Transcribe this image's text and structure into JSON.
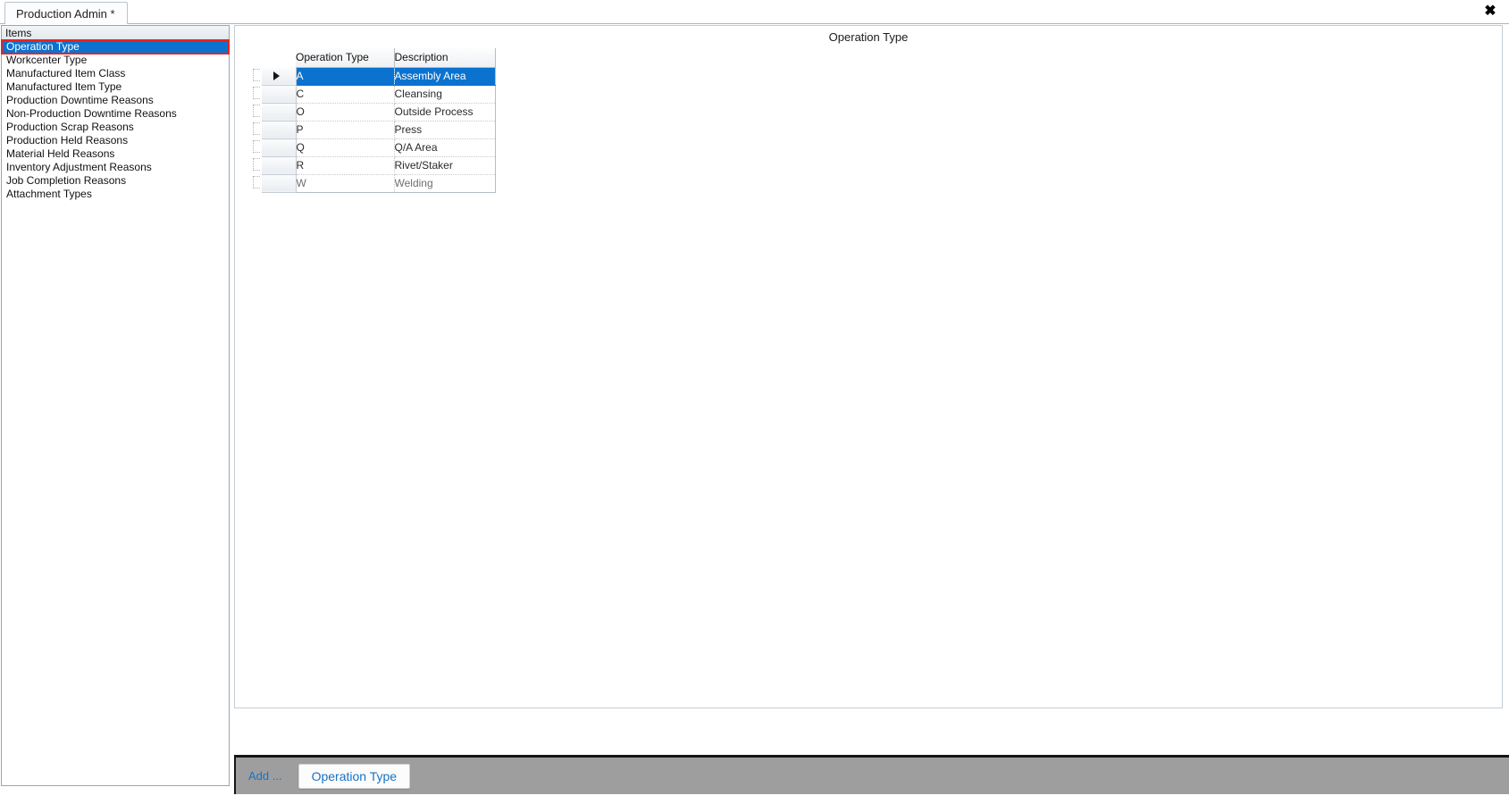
{
  "window": {
    "tab_label": "Production Admin *",
    "close_icon": "close-icon",
    "close_glyph": "✖"
  },
  "sidebar": {
    "header": "Items",
    "selected_index": 0,
    "items": [
      {
        "label": "Operation Type"
      },
      {
        "label": "Workcenter Type"
      },
      {
        "label": "Manufactured Item Class"
      },
      {
        "label": "Manufactured Item Type"
      },
      {
        "label": "Production Downtime Reasons"
      },
      {
        "label": "Non-Production Downtime Reasons"
      },
      {
        "label": "Production Scrap Reasons"
      },
      {
        "label": "Production Held Reasons"
      },
      {
        "label": "Material Held Reasons"
      },
      {
        "label": "Inventory Adjustment Reasons"
      },
      {
        "label": "Job Completion Reasons"
      },
      {
        "label": "Attachment Types"
      }
    ]
  },
  "content": {
    "title": "Operation Type",
    "grid": {
      "columns": [
        "Operation Type",
        "Description"
      ],
      "selected_row": 0,
      "rows": [
        {
          "code": "A",
          "description": "Assembly Area"
        },
        {
          "code": "C",
          "description": "Cleansing"
        },
        {
          "code": "O",
          "description": "Outside Process"
        },
        {
          "code": "P",
          "description": "Press"
        },
        {
          "code": "Q",
          "description": "Q/A Area"
        },
        {
          "code": "R",
          "description": "Rivet/Staker"
        },
        {
          "code": "W",
          "description": "Welding"
        }
      ]
    }
  },
  "toolbar": {
    "add_label": "Add ...",
    "add_button_label": "Operation Type"
  },
  "colors": {
    "selection_blue": "#0b72cf",
    "highlight_red": "#e8231f",
    "link_blue": "#1673c4",
    "toolbar_gray": "#9e9e9e"
  }
}
